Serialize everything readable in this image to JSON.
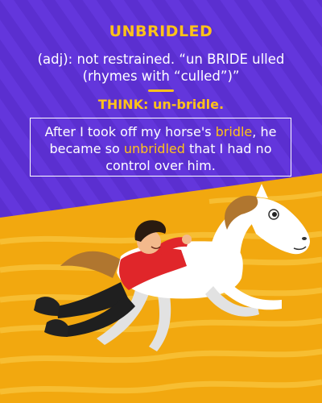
{
  "title": "UNBRIDLED",
  "definition": "(adj): not restrained. “un BRIDE ulled (rhymes with “culled”)”",
  "think": "THINK: un-bridle.",
  "sentence": {
    "part1": "After I took off my horse's ",
    "highlight1": "bridle",
    "part2": ", he became so ",
    "highlight2": "unbridled",
    "part3": " that I had no control over him."
  },
  "colors": {
    "background_purple": "#5b2fd0",
    "accent_yellow": "#ffc21a",
    "sand_orange": "#f2a80f",
    "rider_shirt": "#e0262a"
  },
  "illustration": {
    "description_icons": [
      "horse-icon",
      "rider-icon"
    ]
  }
}
